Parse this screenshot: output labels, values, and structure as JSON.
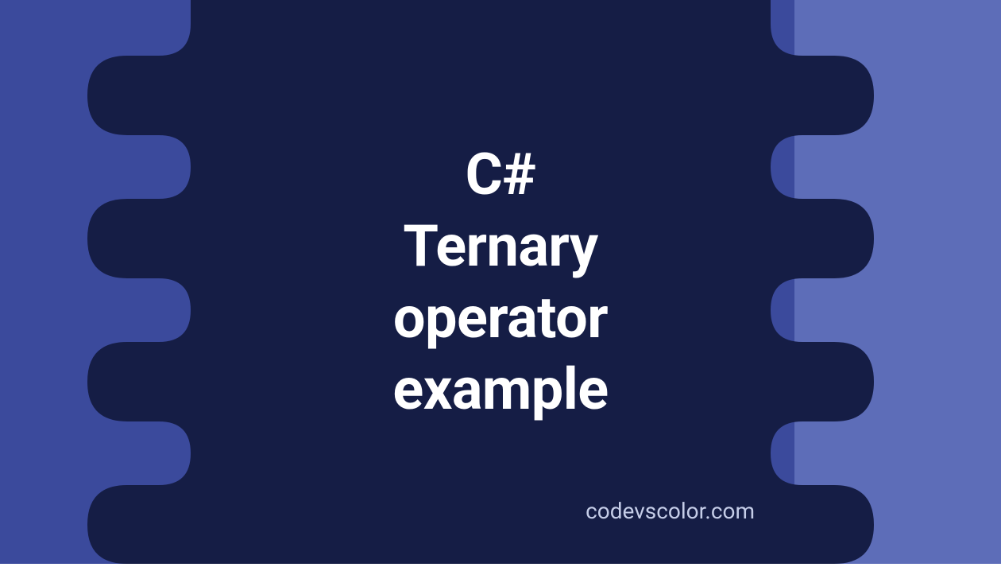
{
  "title": {
    "line1": "C#",
    "line2": "Ternary",
    "line3": "operator",
    "line4": "example"
  },
  "watermark": "codevscolor.com",
  "colors": {
    "bg_left": "#3b4a9c",
    "bg_right": "#5d6db8",
    "blob": "#151d45",
    "text": "#ffffff",
    "watermark_text": "#c5cde8"
  }
}
